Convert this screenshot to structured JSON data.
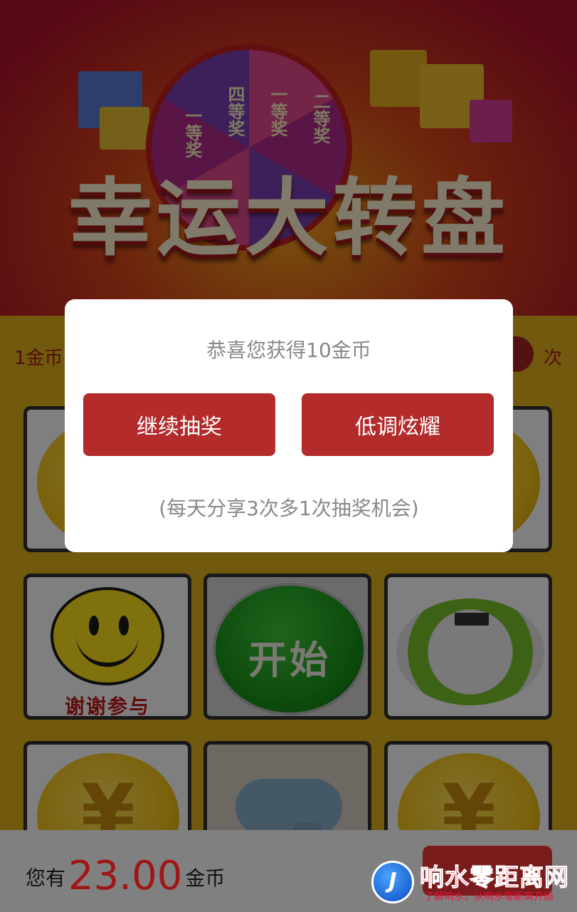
{
  "banner": {
    "title": "幸运大转盘",
    "wheel_labels": [
      "一等奖",
      "四等奖",
      "一等奖",
      "二等奖"
    ]
  },
  "info": {
    "left_text": "1金币",
    "right_text": "次"
  },
  "grid": {
    "coin_symbol": "¥",
    "thanks_label": "谢谢参与",
    "start_label": "开始"
  },
  "dialog": {
    "title": "恭喜您获得10金币",
    "continue_label": "继续抽奖",
    "share_label": "低调炫耀",
    "note": "(每天分享3次多1次抽奖机会)"
  },
  "footer": {
    "prefix": "您有",
    "amount": "23.00",
    "unit": "金币"
  },
  "watermark": {
    "logo_glyph": "J",
    "name": "响水零距离网",
    "slogan": "了解响水，从响水零距离开始"
  },
  "colors": {
    "dialog_button": "#b32b2b",
    "accent_red": "#a01515",
    "page_bg": "#e3b21c"
  }
}
